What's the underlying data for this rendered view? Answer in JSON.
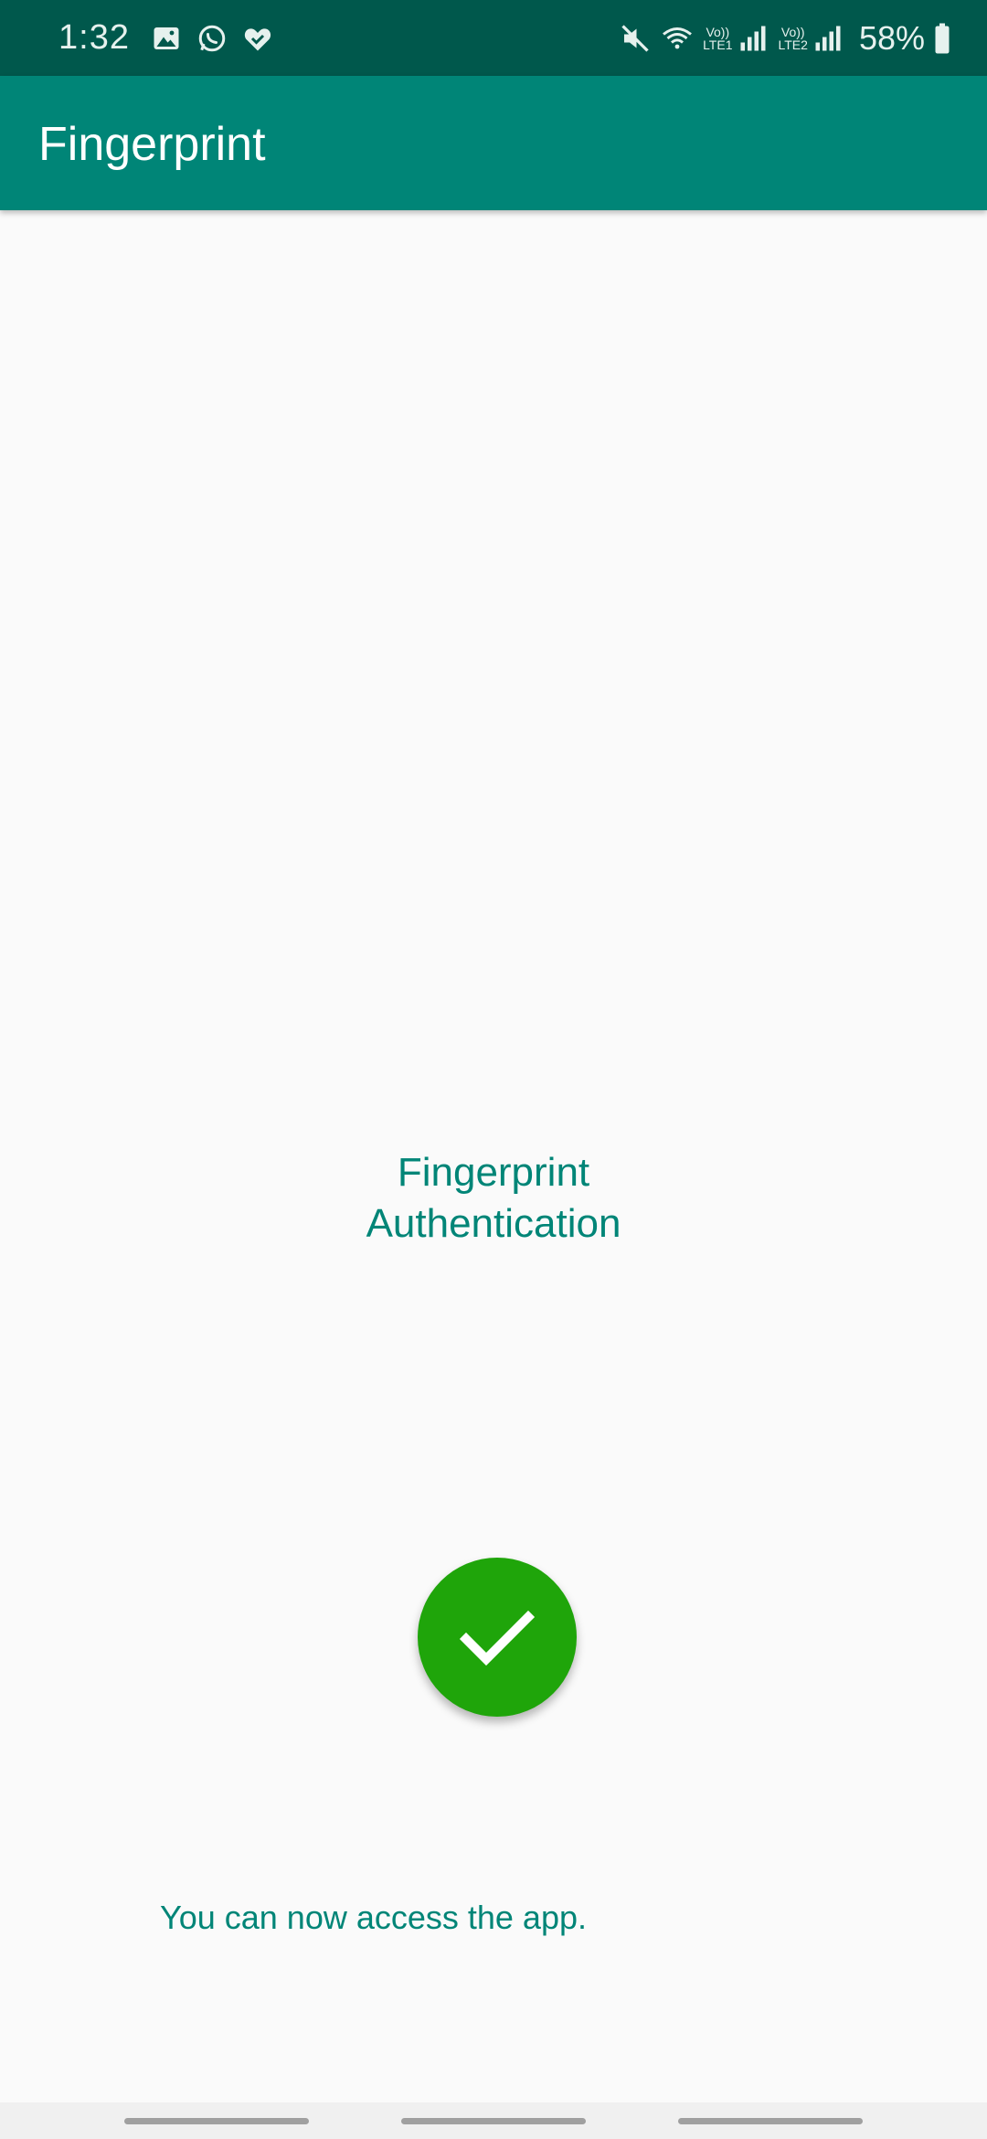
{
  "status_bar": {
    "time": "1:32",
    "left_icons": [
      "gallery-icon",
      "whatsapp-icon",
      "health-heart-icon"
    ],
    "sim1_label_top": "Vo))",
    "sim1_label_bottom": "LTE1",
    "sim2_label_top": "Vo))",
    "sim2_label_bottom": "LTE2",
    "battery_percent": "58%"
  },
  "app_bar": {
    "title": "Fingerprint"
  },
  "main": {
    "auth_title_line1": "Fingerprint",
    "auth_title_line2": "Authentication",
    "success_icon": "check-icon",
    "message": "You can now access the app."
  },
  "colors": {
    "status_bar": "#00584c",
    "app_bar": "#008577",
    "accent_text": "#008577",
    "success": "#1fa50a",
    "background": "#fafafa"
  }
}
